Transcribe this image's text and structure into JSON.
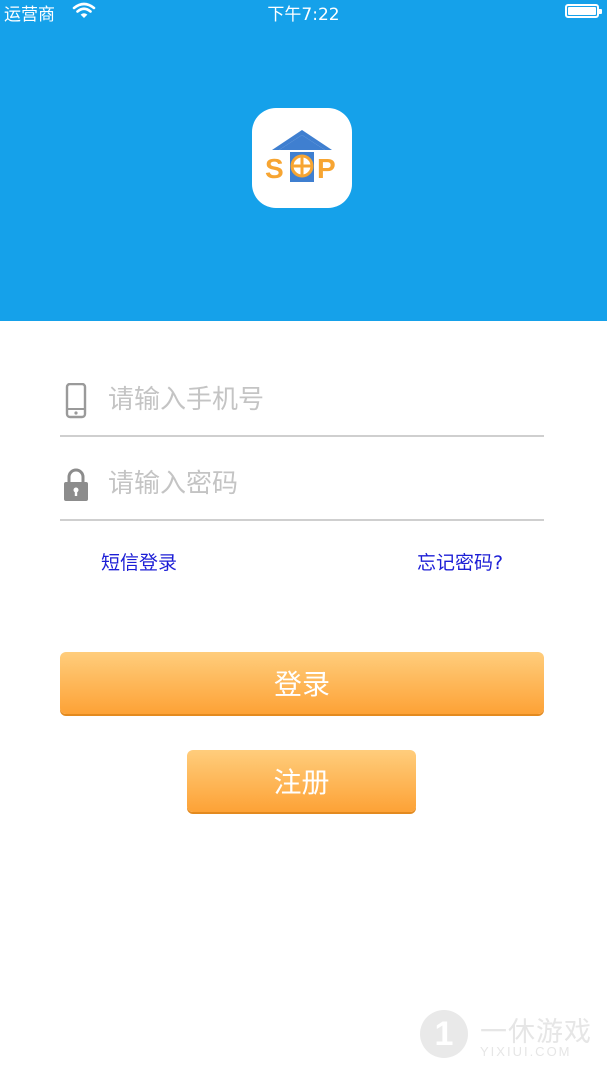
{
  "status_bar": {
    "carrier": "运营商",
    "time": "下午7:22"
  },
  "app": {
    "logo_text": "SOP",
    "brand_color": "#15a1ea",
    "logo_house_color": "#3f7fd0",
    "logo_letter_color": "#f7a532"
  },
  "login_form": {
    "phone_placeholder": "请输入手机号",
    "password_placeholder": "请输入密码",
    "sms_login_link": "短信登录",
    "forgot_password_link": "忘记密码?",
    "login_button": "登录",
    "register_button": "注册",
    "link_color": "#1c1ed6",
    "button_color": "#fda236"
  },
  "watermark": {
    "number": "1",
    "name_cn": "一休游戏",
    "name_en": "YIXIUI.COM"
  },
  "icons": {
    "wifi": "wifi-icon",
    "battery": "battery-icon",
    "phone": "phone-icon",
    "lock": "lock-icon"
  }
}
